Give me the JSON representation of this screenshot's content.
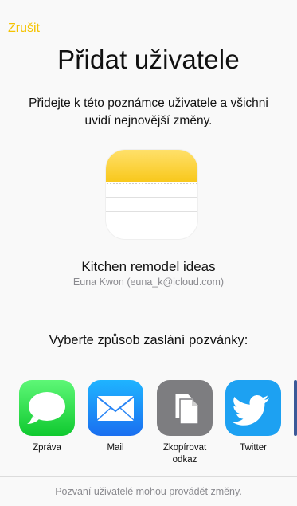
{
  "header": {
    "cancel_label": "Zrušit",
    "title": "Přidat uživatele",
    "subtitle": "Přidejte k této poznámce uživatele a všichni uvidí nejnovější změny."
  },
  "note": {
    "name": "Kitchen remodel ideas",
    "owner": "Euna Kwon (euna_k@icloud.com)"
  },
  "share": {
    "heading": "Vyberte způsob zaslání pozvánky:",
    "apps": [
      {
        "label": "Zpráva",
        "icon": "messages-icon"
      },
      {
        "label": "Mail",
        "icon": "mail-icon"
      },
      {
        "label": "Zkopírovat odkaz",
        "icon": "copy-icon"
      },
      {
        "label": "Twitter",
        "icon": "twitter-icon"
      }
    ]
  },
  "footer": {
    "text": "Pozvaní uživatelé mohou provádět změny."
  },
  "colors": {
    "accent": "#f5c300",
    "background": "#f9f9f9",
    "secondary_text": "#8a8a8f"
  }
}
